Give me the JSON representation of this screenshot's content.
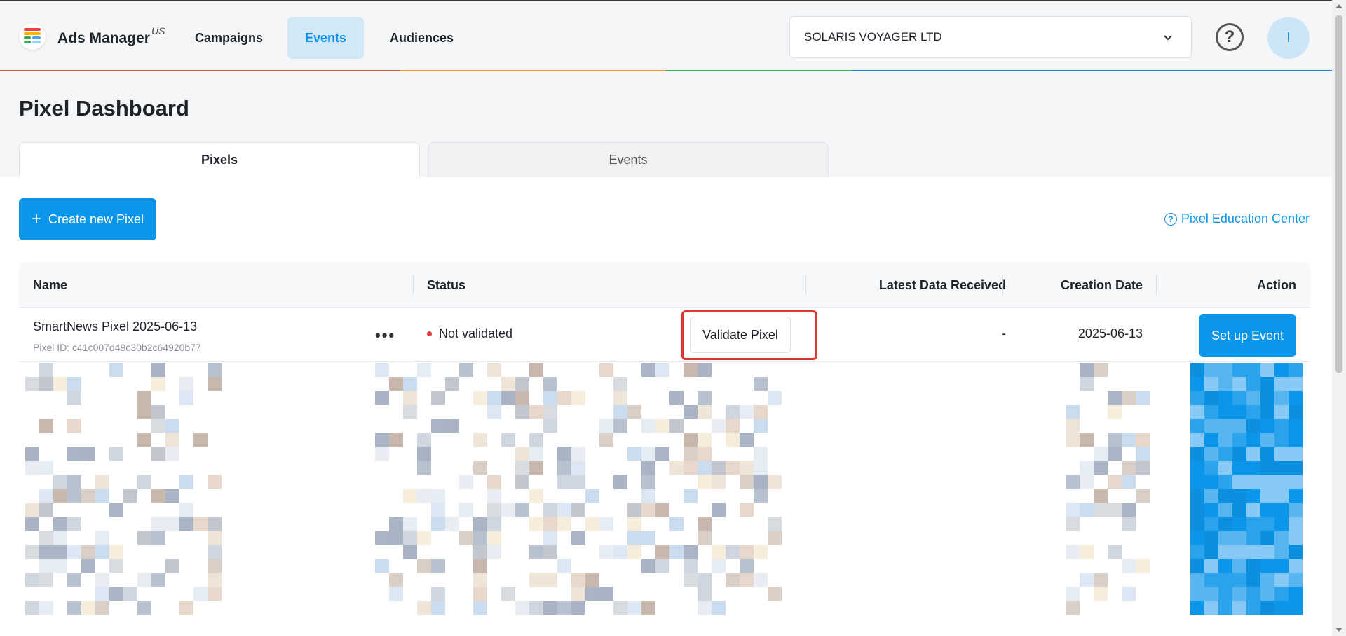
{
  "app": {
    "name": "Ads Manager",
    "region": "US"
  },
  "nav": {
    "items": [
      {
        "label": "Campaigns",
        "active": false
      },
      {
        "label": "Events",
        "active": true
      },
      {
        "label": "Audiences",
        "active": false
      }
    ]
  },
  "account": {
    "selected": "SOLARIS VOYAGER LTD"
  },
  "user": {
    "initial": "I"
  },
  "help": {
    "icon": "question-circle-icon",
    "glyph": "?"
  },
  "page": {
    "title": "Pixel Dashboard"
  },
  "tabs": [
    {
      "label": "Pixels",
      "active": true
    },
    {
      "label": "Events",
      "active": false
    }
  ],
  "toolbar": {
    "create_label": "Create new Pixel",
    "create_icon": "+",
    "education_label": "Pixel Education Center",
    "education_icon": "?"
  },
  "table": {
    "columns": [
      "Name",
      "Status",
      "Latest Data Received",
      "Creation Date",
      "Action"
    ],
    "rows": [
      {
        "name": "SmartNews Pixel 2025-06-13",
        "pixel_id": "Pixel ID: c41c007d49c30b2c64920b77",
        "more": "•••",
        "status": "Not validated",
        "validate_label": "Validate Pixel",
        "latest_data": "-",
        "creation_date": "2025-06-13",
        "action_label": "Set up Event"
      }
    ]
  },
  "colors": {
    "accent": "#0b96ea",
    "nav_active_bg": "#d3e8f7",
    "status_dot": "#e03c3c",
    "highlight_border": "#d9392c"
  }
}
